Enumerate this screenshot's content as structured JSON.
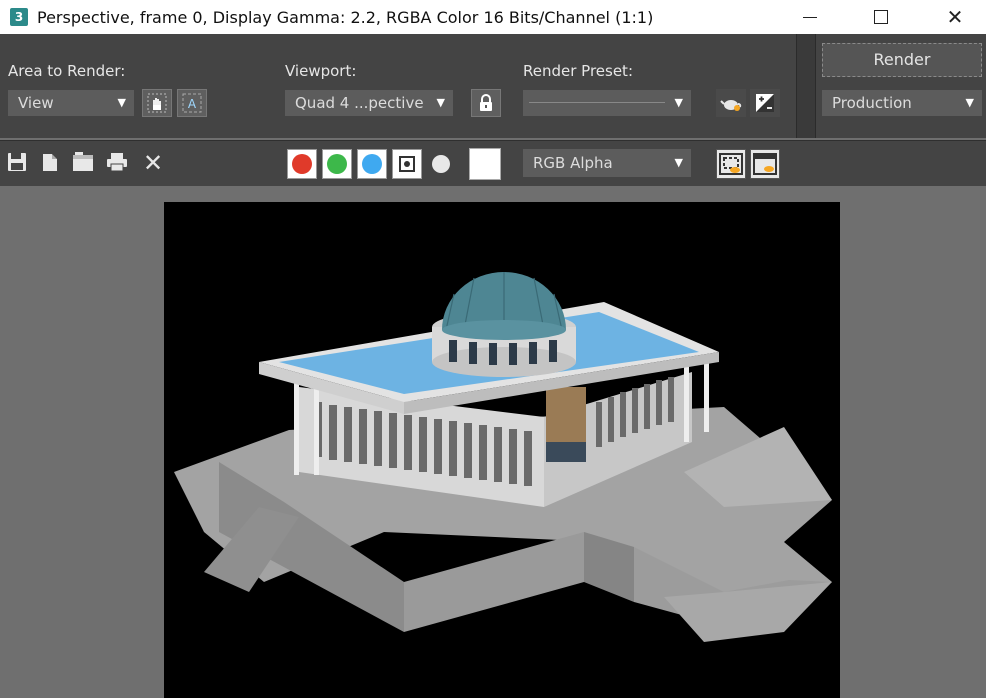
{
  "window": {
    "title": "Perspective, frame 0, Display Gamma: 2.2, RGBA Color 16 Bits/Channel (1:1)",
    "app_icon_glyph": "3"
  },
  "toolbar": {
    "area_label": "Area to Render:",
    "area_value": "View",
    "viewport_label": "Viewport:",
    "viewport_value": "Quad 4 ...pective",
    "preset_label": "Render Preset:",
    "preset_value": "",
    "render_button": "Render",
    "mode_value": "Production"
  },
  "toolbar2": {
    "channel_value": "RGB Alpha",
    "channels": [
      {
        "name": "red-channel",
        "color": "#e03a2a"
      },
      {
        "name": "green-channel",
        "color": "#3db84a"
      },
      {
        "name": "blue-channel",
        "color": "#3fa9f0"
      }
    ]
  },
  "viewport": {
    "image": "rendered building (national assembly) with blue roof and dome on stepped plaza"
  }
}
